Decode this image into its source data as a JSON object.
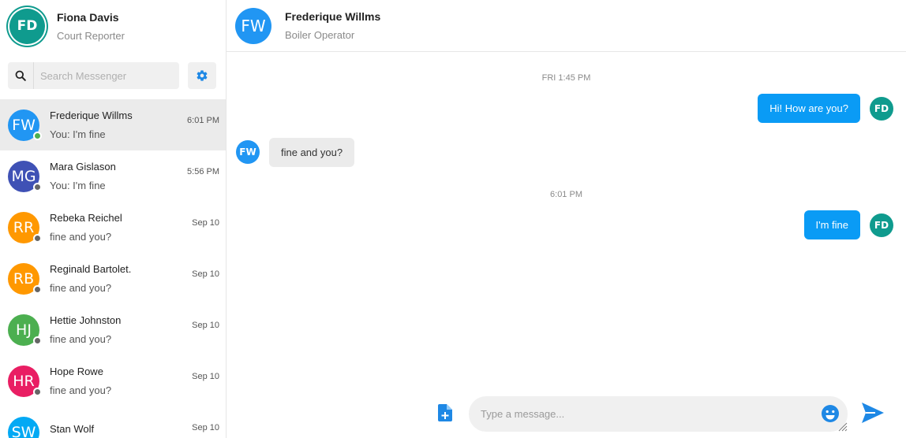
{
  "me": {
    "initials": "FD",
    "name": "Fiona Davis",
    "role": "Court Reporter",
    "color": "#0f9b8e"
  },
  "search": {
    "placeholder": "Search Messenger",
    "icon": "search-icon"
  },
  "settings": {
    "icon": "gear-icon"
  },
  "conversations": [
    {
      "initials": "FW",
      "name": "Frederique Willms",
      "preview": "You: I'm fine",
      "time": "6:01 PM",
      "color": "#2196f3",
      "online": true
    },
    {
      "initials": "MG",
      "name": "Mara Gislason",
      "preview": "You: I'm fine",
      "time": "5:56 PM",
      "color": "#3f51b5",
      "online": false
    },
    {
      "initials": "RR",
      "name": "Rebeka Reichel",
      "preview": "fine and you?",
      "time": "Sep 10",
      "color": "#ff9800",
      "online": false
    },
    {
      "initials": "RB",
      "name": "Reginald Bartolet.",
      "preview": "fine and you?",
      "time": "Sep 10",
      "color": "#ff9800",
      "online": false
    },
    {
      "initials": "HJ",
      "name": "Hettie Johnston",
      "preview": "fine and you?",
      "time": "Sep 10",
      "color": "#4caf50",
      "online": false
    },
    {
      "initials": "HR",
      "name": "Hope Rowe",
      "preview": "fine and you?",
      "time": "Sep 10",
      "color": "#e91e63",
      "online": false
    },
    {
      "initials": "SW",
      "name": "Stan Wolf",
      "preview": "",
      "time": "Sep 10",
      "color": "#03a9f4",
      "online": false
    }
  ],
  "chat": {
    "contact": {
      "initials": "FW",
      "name": "Frederique Willms",
      "role": "Boiler Operator",
      "color": "#2196f3"
    },
    "timestamps": [
      "FRI 1:45 PM",
      "6:01 PM"
    ],
    "messages": [
      {
        "direction": "out",
        "text": "Hi! How are you?",
        "avatar": "FD"
      },
      {
        "direction": "in",
        "text": "fine and you?",
        "avatar": "FW"
      },
      {
        "direction": "out",
        "text": "I'm fine",
        "avatar": "FD"
      }
    ]
  },
  "composer": {
    "placeholder": "Type a message...",
    "attach_icon": "file-add-icon",
    "emoji_icon": "emoji-icon",
    "send_icon": "send-icon"
  },
  "colors": {
    "accent": "#0a9bf5",
    "online": "#4caf50",
    "offline": "#666666",
    "incoming_bubble": "#ebebeb"
  }
}
